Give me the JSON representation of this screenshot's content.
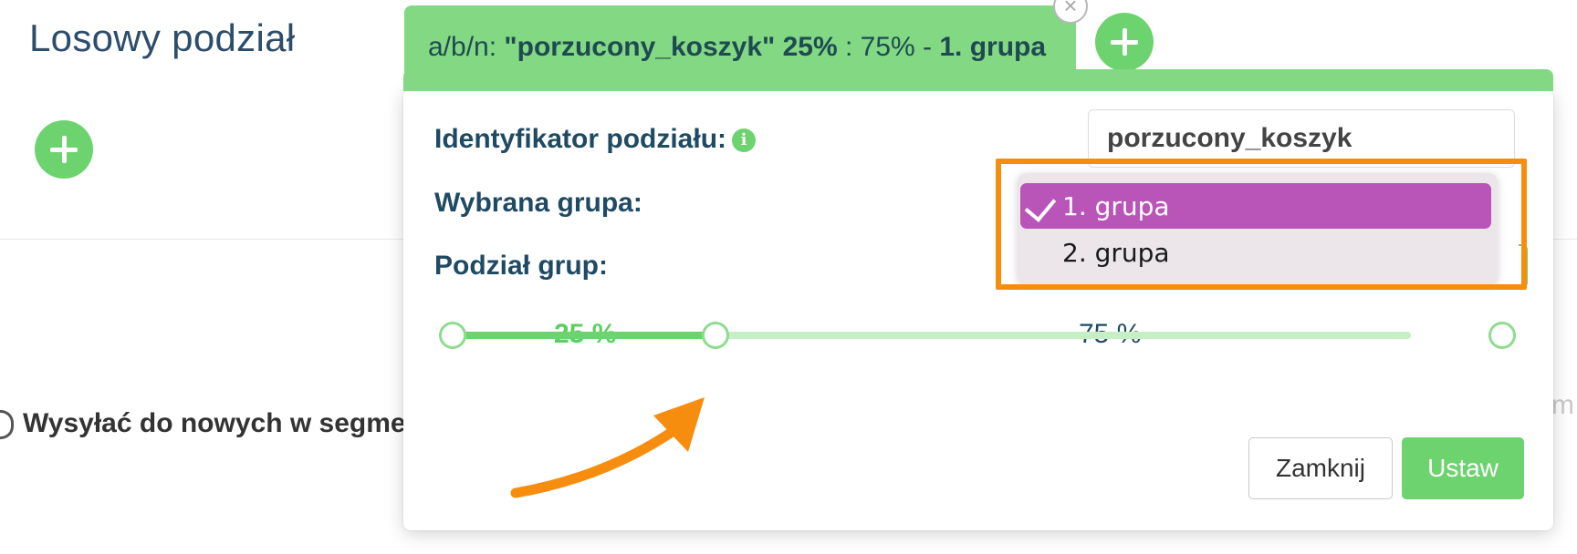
{
  "page": {
    "title": "Losowy podział",
    "background_option": "Wysyłać do nowych w segme",
    "edge_letter": "m"
  },
  "modal": {
    "tab": {
      "prefix": "a/b/n",
      "name": "\"porzucony_koszyk\" 25%",
      "middle": " : 75% - ",
      "group": "1. grupa",
      "close_symbol": "×"
    },
    "fields": {
      "identifier_label": "Identyfikator podziału:",
      "identifier_value": "porzucony_koszyk",
      "info_symbol": "i",
      "selected_group_label": "Wybrana grupa:",
      "group_split_label": "Podział grup:",
      "select_arrow": "✓"
    },
    "dropdown": {
      "options": [
        "1. grupa",
        "2. grupa"
      ],
      "selected": "1. grupa"
    },
    "split": {
      "group_a_percent": "25 %",
      "group_b_percent": "75 %",
      "group_a_fraction": 0.25
    },
    "buttons": {
      "close": "Zamknij",
      "set": "Ustaw"
    }
  },
  "colors": {
    "accent_green": "#6dd36f",
    "tab_green": "#82d883",
    "selection_purple": "#b955b9",
    "highlight_orange": "#f78d0e",
    "text_navy": "#1f4a63"
  }
}
